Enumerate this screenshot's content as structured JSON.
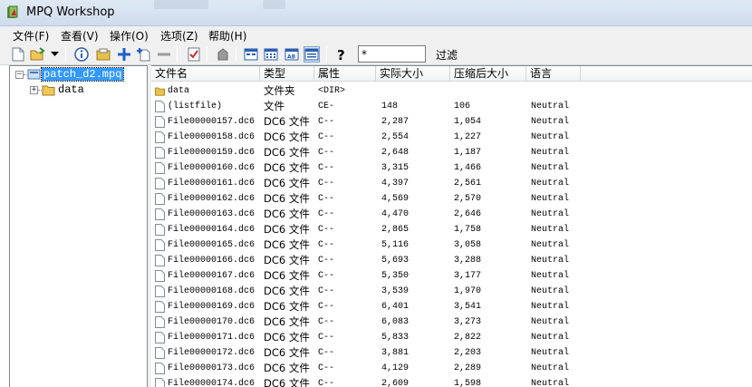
{
  "window": {
    "title": "MPQ Workshop"
  },
  "menu": [
    {
      "label": "文件(F)"
    },
    {
      "label": "查看(V)"
    },
    {
      "label": "操作(O)"
    },
    {
      "label": "选项(Z)"
    },
    {
      "label": "帮助(H)"
    }
  ],
  "toolbar": {
    "filter_value": "*",
    "filter_label": "过滤"
  },
  "tree": {
    "root": {
      "label": "patch_d2.mpq",
      "expander": "−"
    },
    "child": {
      "label": "data",
      "expander": "+"
    }
  },
  "columns": [
    {
      "label": "文件名"
    },
    {
      "label": "类型"
    },
    {
      "label": "属性"
    },
    {
      "label": "实际大小"
    },
    {
      "label": "压缩后大小"
    },
    {
      "label": "语言"
    }
  ],
  "rows": [
    {
      "name": "data",
      "type": "文件夹",
      "attr": "<DIR>",
      "size": "",
      "packed": "",
      "lang": "",
      "icon": "folder-icon"
    },
    {
      "name": "(listfile)",
      "type": "文件",
      "attr": "CE-",
      "size": "148",
      "packed": "106",
      "lang": "Neutral",
      "icon": "file-icon"
    },
    {
      "name": "File00000157.dc6",
      "type": "DC6 文件",
      "attr": "C--",
      "size": "2,287",
      "packed": "1,054",
      "lang": "Neutral",
      "icon": "file-icon"
    },
    {
      "name": "File00000158.dc6",
      "type": "DC6 文件",
      "attr": "C--",
      "size": "2,554",
      "packed": "1,227",
      "lang": "Neutral",
      "icon": "file-icon"
    },
    {
      "name": "File00000159.dc6",
      "type": "DC6 文件",
      "attr": "C--",
      "size": "2,648",
      "packed": "1,187",
      "lang": "Neutral",
      "icon": "file-icon"
    },
    {
      "name": "File00000160.dc6",
      "type": "DC6 文件",
      "attr": "C--",
      "size": "3,315",
      "packed": "1,466",
      "lang": "Neutral",
      "icon": "file-icon"
    },
    {
      "name": "File00000161.dc6",
      "type": "DC6 文件",
      "attr": "C--",
      "size": "4,397",
      "packed": "2,561",
      "lang": "Neutral",
      "icon": "file-icon"
    },
    {
      "name": "File00000162.dc6",
      "type": "DC6 文件",
      "attr": "C--",
      "size": "4,569",
      "packed": "2,570",
      "lang": "Neutral",
      "icon": "file-icon"
    },
    {
      "name": "File00000163.dc6",
      "type": "DC6 文件",
      "attr": "C--",
      "size": "4,470",
      "packed": "2,646",
      "lang": "Neutral",
      "icon": "file-icon"
    },
    {
      "name": "File00000164.dc6",
      "type": "DC6 文件",
      "attr": "C--",
      "size": "2,865",
      "packed": "1,758",
      "lang": "Neutral",
      "icon": "file-icon"
    },
    {
      "name": "File00000165.dc6",
      "type": "DC6 文件",
      "attr": "C--",
      "size": "5,116",
      "packed": "3,058",
      "lang": "Neutral",
      "icon": "file-icon"
    },
    {
      "name": "File00000166.dc6",
      "type": "DC6 文件",
      "attr": "C--",
      "size": "5,693",
      "packed": "3,288",
      "lang": "Neutral",
      "icon": "file-icon"
    },
    {
      "name": "File00000167.dc6",
      "type": "DC6 文件",
      "attr": "C--",
      "size": "5,350",
      "packed": "3,177",
      "lang": "Neutral",
      "icon": "file-icon"
    },
    {
      "name": "File00000168.dc6",
      "type": "DC6 文件",
      "attr": "C--",
      "size": "3,539",
      "packed": "1,970",
      "lang": "Neutral",
      "icon": "file-icon"
    },
    {
      "name": "File00000169.dc6",
      "type": "DC6 文件",
      "attr": "C--",
      "size": "6,401",
      "packed": "3,541",
      "lang": "Neutral",
      "icon": "file-icon"
    },
    {
      "name": "File00000170.dc6",
      "type": "DC6 文件",
      "attr": "C--",
      "size": "6,083",
      "packed": "3,273",
      "lang": "Neutral",
      "icon": "file-icon"
    },
    {
      "name": "File00000171.dc6",
      "type": "DC6 文件",
      "attr": "C--",
      "size": "5,833",
      "packed": "2,822",
      "lang": "Neutral",
      "icon": "file-icon"
    },
    {
      "name": "File00000172.dc6",
      "type": "DC6 文件",
      "attr": "C--",
      "size": "3,881",
      "packed": "2,203",
      "lang": "Neutral",
      "icon": "file-icon"
    },
    {
      "name": "File00000173.dc6",
      "type": "DC6 文件",
      "attr": "C--",
      "size": "4,129",
      "packed": "2,289",
      "lang": "Neutral",
      "icon": "file-icon"
    },
    {
      "name": "File00000174.dc6",
      "type": "DC6 文件",
      "attr": "C--",
      "size": "2,609",
      "packed": "1,598",
      "lang": "Neutral",
      "icon": "file-icon"
    }
  ],
  "icons": {
    "app": "mpq-app-icon",
    "toolbar": [
      "new-file-icon",
      "open-folder-icon",
      "dropdown-arrow-icon",
      "info-icon",
      "archive-icon",
      "add-icon",
      "add-file-icon",
      "remove-icon",
      "checklist-icon",
      "extract-icon",
      "large-icons-view-icon",
      "details-view-icon",
      "list-view-icon",
      "report-view-icon",
      "help-icon"
    ]
  },
  "colors": {
    "selection": "#3399ff",
    "folder": "#e8c14a",
    "titlebar": "#dfe9f5"
  }
}
